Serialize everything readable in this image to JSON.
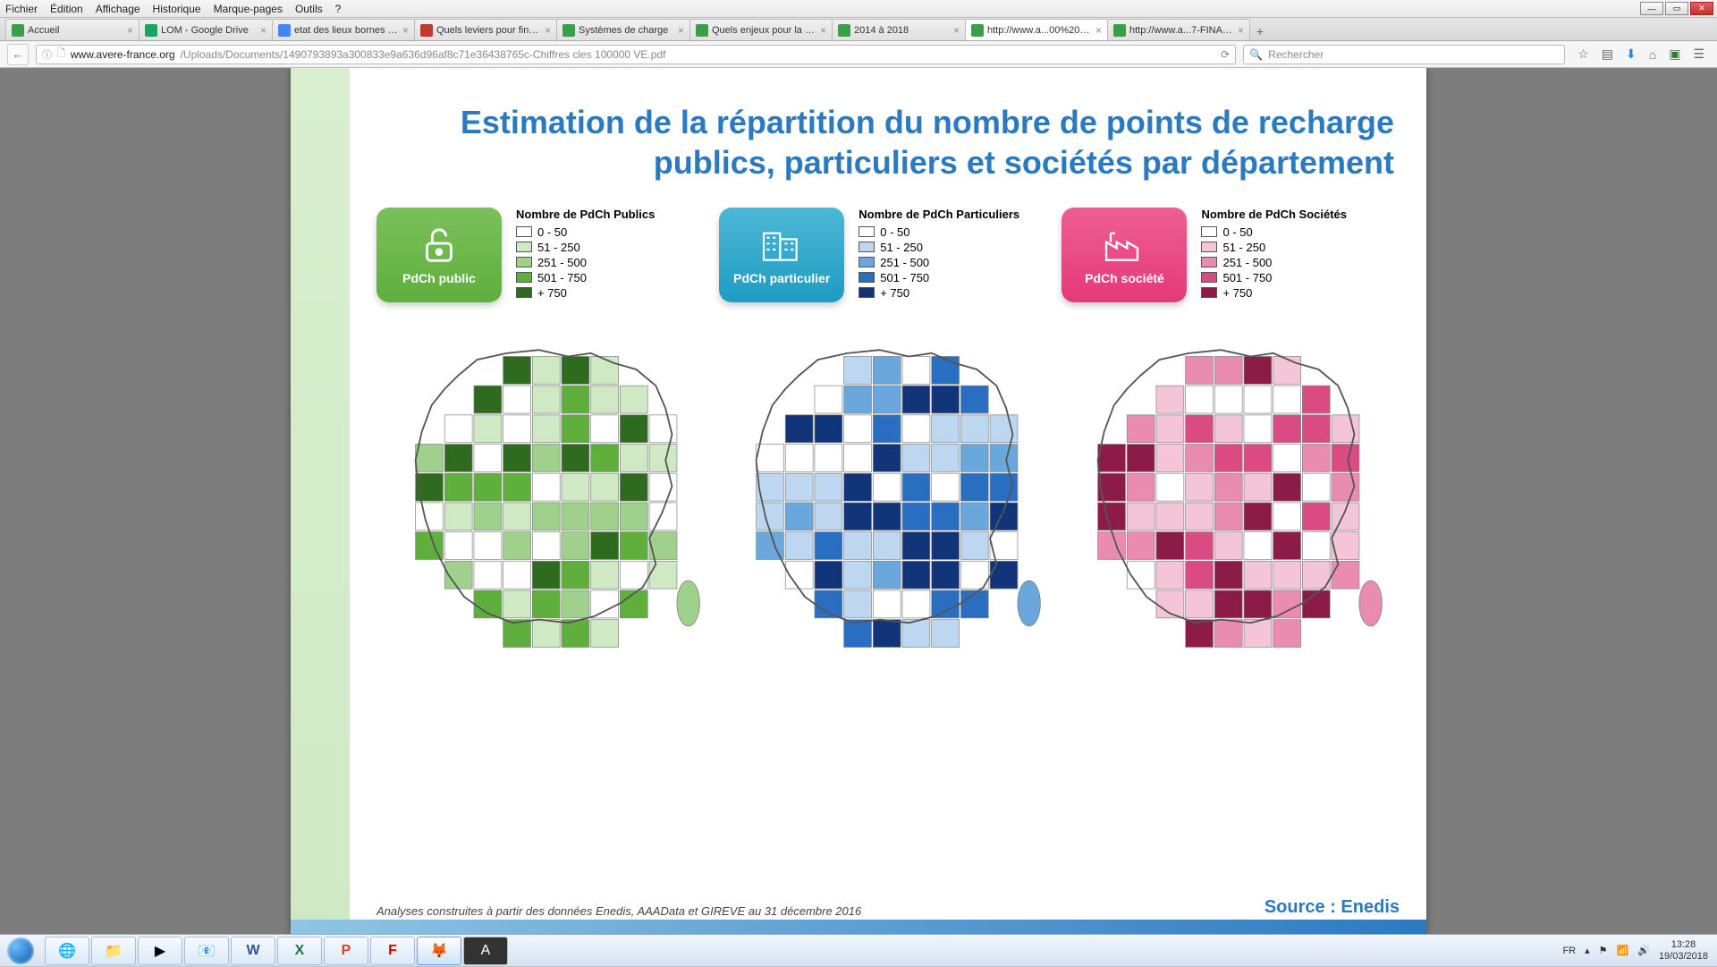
{
  "menubar": [
    "Fichier",
    "Édition",
    "Affichage",
    "Historique",
    "Marque-pages",
    "Outils",
    "?"
  ],
  "tabs": [
    {
      "label": "Accueil",
      "color": "#3b9e4a"
    },
    {
      "label": "LOM - Google Drive",
      "color": "#1da362"
    },
    {
      "label": "etat des lieux bornes de re...",
      "color": "#4285f4"
    },
    {
      "label": "Quels leviers pour finance...",
      "color": "#c0392b"
    },
    {
      "label": "Systèmes de charge",
      "color": "#3b9e4a"
    },
    {
      "label": "Quels enjeux pour la recha...",
      "color": "#3b9e4a"
    },
    {
      "label": "2014 à 2018",
      "color": "#3b9e4a"
    },
    {
      "label": "http://www.a...00%20VE.pdf",
      "color": "#3b9e4a",
      "active": true
    },
    {
      "label": "http://www.a...7-FINAL.pdf",
      "color": "#3b9e4a"
    }
  ],
  "url": {
    "host": "www.avere-france.org",
    "rest": "/Uploads/Documents/1490793893a300833e9a636d96af8c71e36438765c-Chiffres cles 100000 VE.pdf"
  },
  "search_placeholder": "Rechercher",
  "doc": {
    "title": "Estimation de la répartition du nombre de points de recharge publics, particuliers et sociétés par département",
    "categories": [
      {
        "badge": "PdCh public",
        "legend_title": "Nombre de PdCh Publics"
      },
      {
        "badge": "PdCh particulier",
        "legend_title": "Nombre de PdCh Particuliers"
      },
      {
        "badge": "PdCh société",
        "legend_title": "Nombre de PdCh Sociétés"
      }
    ],
    "legend_ranges": [
      "0 - 50",
      "51 - 250",
      "251 - 500",
      "501 - 750",
      "+ 750"
    ],
    "footnote": "Analyses construites à partir des données Enedis, AAAData et GIREVE  au 31 décembre 2016",
    "source": "Source : Enedis"
  },
  "tray": {
    "lang": "FR",
    "time": "13:28",
    "date": "19/03/2018"
  }
}
